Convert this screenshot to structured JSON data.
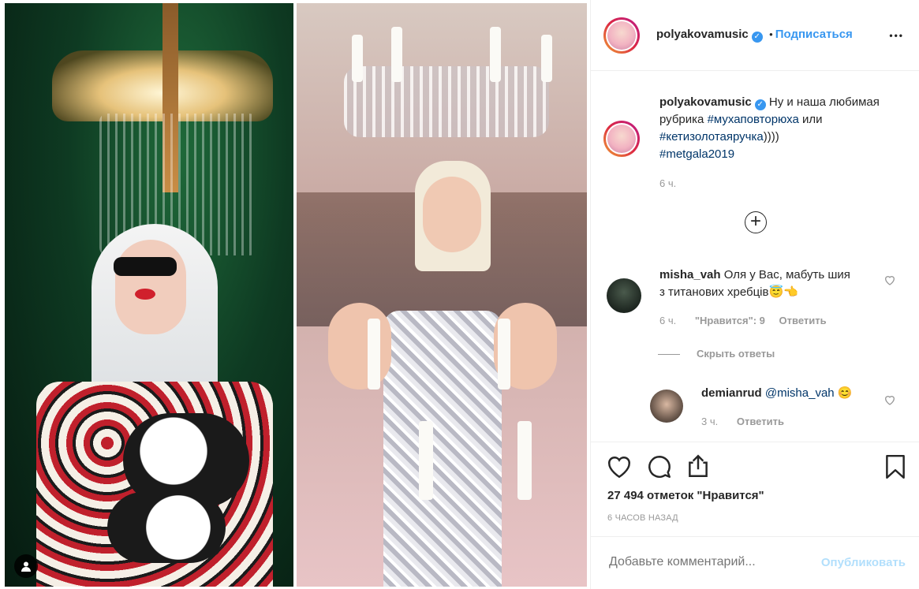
{
  "post": {
    "author": "polyakovamusic",
    "verified_mark": "✓",
    "separator": "•",
    "follow_label": "Подписаться",
    "more_label": "•••",
    "caption_author": "polyakovamusic",
    "caption_text_1": "Ну и наша любимая рубрика ",
    "caption_tag_1": "#мухаповторюха",
    "caption_text_2": " или ",
    "caption_tag_2": "#кетизолотаяручка",
    "caption_text_3": "))))",
    "caption_tag_3": "#metgala2019",
    "caption_time": "6 ч.",
    "load_more_icon": "+"
  },
  "comments": [
    {
      "author": "misha_vah",
      "text": "Оля у Вас, мабуть шия з титанових хребців😇👈",
      "time": "6 ч.",
      "likes": "\"Нравится\": 9",
      "reply": "Ответить",
      "hide_replies": "Скрыть ответы"
    },
    {
      "author": "demianrud",
      "text": "@misha_vah 😊",
      "time": "3 ч.",
      "reply": "Ответить"
    }
  ],
  "actions": {
    "likes_count": "27 494 отметок \"Нравится\"",
    "time_ago": "6 ЧАСОВ НАЗАД",
    "comment_placeholder": "Добавьте комментарий...",
    "publish_label": "Опубликовать"
  },
  "icons": {
    "like": "heart-icon",
    "comment": "comment-icon",
    "share": "share-icon",
    "save": "bookmark-icon",
    "user_tag": "user-icon"
  },
  "colors": {
    "accent": "#3897f0",
    "hashtag": "#003569",
    "muted": "#999999",
    "publish_disabled": "#b2dffc"
  }
}
